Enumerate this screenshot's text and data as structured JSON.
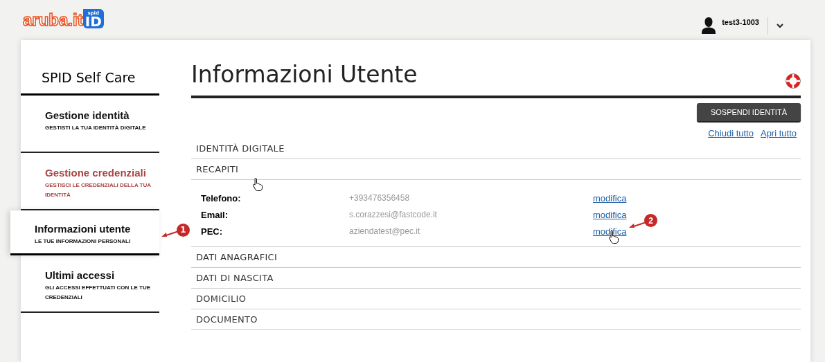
{
  "header": {
    "logo_text": "aruba.it",
    "logo_badge_top": "spid",
    "logo_badge": "ID",
    "user": "test3-1003"
  },
  "sidebar": {
    "title": "SPID Self Care",
    "items": [
      {
        "title": "Gestione identità",
        "subtitle": "GESTISTI LA TUA IDENTITÀ DIGITALE",
        "selected": false,
        "hovered": false
      },
      {
        "title": "Gestione credenziali",
        "subtitle": "GESTISCI LE CREDENZIALI DELLA TUA IDENTITÀ",
        "selected": false,
        "hovered": true
      },
      {
        "title": "Informazioni utente",
        "subtitle": "LE TUE INFORMAZIONI PERSONALI",
        "selected": true,
        "hovered": false,
        "annotation": "1"
      },
      {
        "title": "Ultimi accessi",
        "subtitle": "GLI ACCESSI EFFETTUATI CON LE TUE CREDENZIALI",
        "selected": false,
        "hovered": false
      }
    ]
  },
  "main": {
    "title": "Informazioni Utente",
    "suspend_button": "SOSPENDI IDENTITÀ",
    "close_all": "Chiudi tutto",
    "open_all": "Apri tutto",
    "sections": [
      {
        "title": "IDENTITÀ DIGITALE",
        "expanded": false
      },
      {
        "title": "RECAPITI",
        "expanded": true,
        "cursor": true,
        "fields": [
          {
            "label": "Telefono:",
            "value": "+393476356458",
            "action": "modifica"
          },
          {
            "label": "Email:",
            "value": "s.corazzesi@fastcode.it",
            "action": "modifica"
          },
          {
            "label": "PEC:",
            "value": "aziendatest@pec.it",
            "action": "modifica",
            "annotation": "2"
          }
        ]
      },
      {
        "title": "DATI ANAGRAFICI",
        "expanded": false
      },
      {
        "title": "DATI DI NASCITA",
        "expanded": false
      },
      {
        "title": "DOMICILIO",
        "expanded": false
      },
      {
        "title": "DOCUMENTO",
        "expanded": false
      }
    ]
  }
}
